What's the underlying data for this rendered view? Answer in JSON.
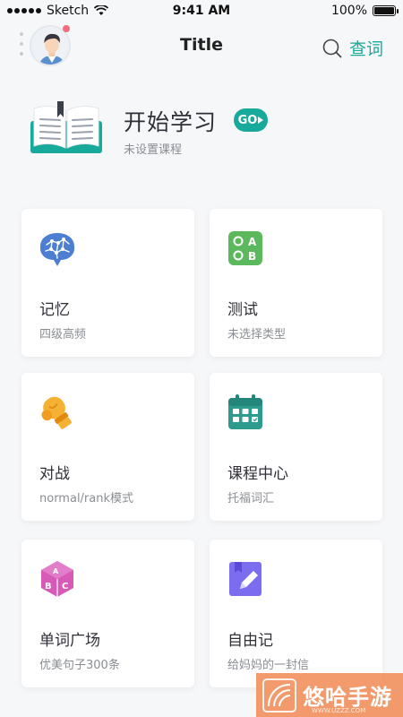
{
  "status_bar": {
    "carrier": "Sketch",
    "time": "9:41 AM",
    "battery": "100%",
    "battery_level": 1.0
  },
  "nav": {
    "title": "Title",
    "search_label": "查词",
    "avatar_icon": "user-avatar",
    "search_icon": "search-icon"
  },
  "course": {
    "title": "开始学习",
    "go_label": "GO",
    "subtitle": "未设置课程"
  },
  "cards": [
    {
      "title": "记忆",
      "subtitle": "四级高频",
      "icon": "brain-icon"
    },
    {
      "title": "测试",
      "subtitle": "未选择类型",
      "icon": "quiz-grid-icon"
    },
    {
      "title": "对战",
      "subtitle": "normal/rank模式",
      "icon": "boxing-glove-icon"
    },
    {
      "title": "课程中心",
      "subtitle": "托福词汇",
      "icon": "calendar-icon"
    },
    {
      "title": "单词广场",
      "subtitle": "优美句子300条",
      "icon": "letter-cube-icon"
    },
    {
      "title": "自由记",
      "subtitle": "给妈妈的一封信",
      "icon": "notebook-pen-icon"
    }
  ],
  "watermark": {
    "text": "悠哈手游",
    "sub": "WWW.UZZZ.COM"
  },
  "colors": {
    "accent": "#17a99a",
    "background": "#f6f7f9",
    "brain": "#4c7fd1",
    "quiz": "#5cb85c",
    "boxing": "#f5b133",
    "calendar": "#2d9c8f",
    "cube": "#d65ab6",
    "notebook": "#7b6cf0"
  }
}
